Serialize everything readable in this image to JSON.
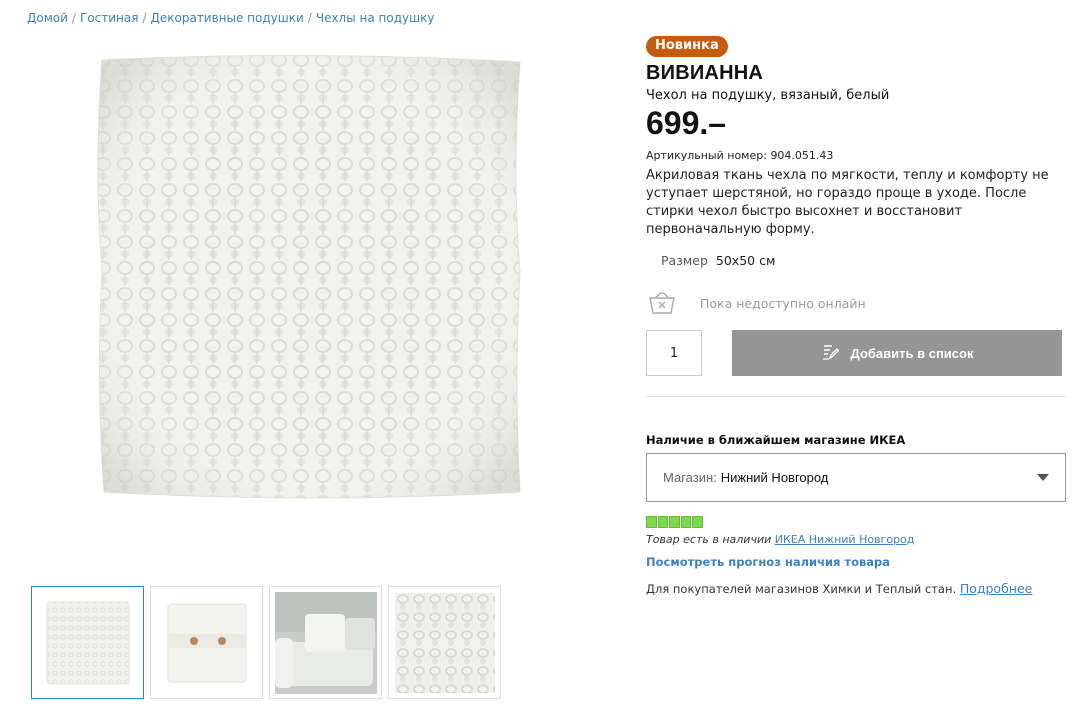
{
  "breadcrumb": [
    {
      "label": "Домой"
    },
    {
      "label": "Гостиная"
    },
    {
      "label": "Декоративные подушки"
    },
    {
      "label": "Чехлы на подушку"
    }
  ],
  "product": {
    "badge": "Новинка",
    "name": "ВИВИАННА",
    "description": "Чехол на подушку, вязаный, белый",
    "price": "699.–",
    "article_label": "Артикульный номер:",
    "article_number": "904.051.43",
    "long_description": "Акриловая ткань чехла по мягкости, теплу и комфорту не уступает шерстяной, но гораздо проще в уходе. После стирки чехол быстро высохнет и восстановит первоначальную форму.",
    "size_label": "Размер",
    "size_value": "50x50 см"
  },
  "availability": {
    "online_text": "Пока недоступно онлайн",
    "quantity": "1",
    "add_button_label": "Добавить в список",
    "store_heading": "Наличие в ближайшем магазине ИКЕА",
    "store_select_label": "Магазин:",
    "store_select_value": "Нижний Новгород",
    "stock_level": 5,
    "stock_max": 5,
    "stock_text": "Товар есть в наличии",
    "stock_store": "ИКЕА Нижний Новгород",
    "forecast_link": "Посмотреть прогноз наличия товара",
    "note_text": "Для покупателей магазинов Химки и Теплый стан.",
    "note_link": "Подробнее"
  },
  "colors": {
    "badge": "#c55a11",
    "link": "#3b7fc4",
    "button": "#959595",
    "stock": "#7dd84f"
  },
  "icons": {
    "unavailable": "basket-cross-icon",
    "add_to_list": "edit-list-icon",
    "dropdown": "chevron-down-icon"
  }
}
